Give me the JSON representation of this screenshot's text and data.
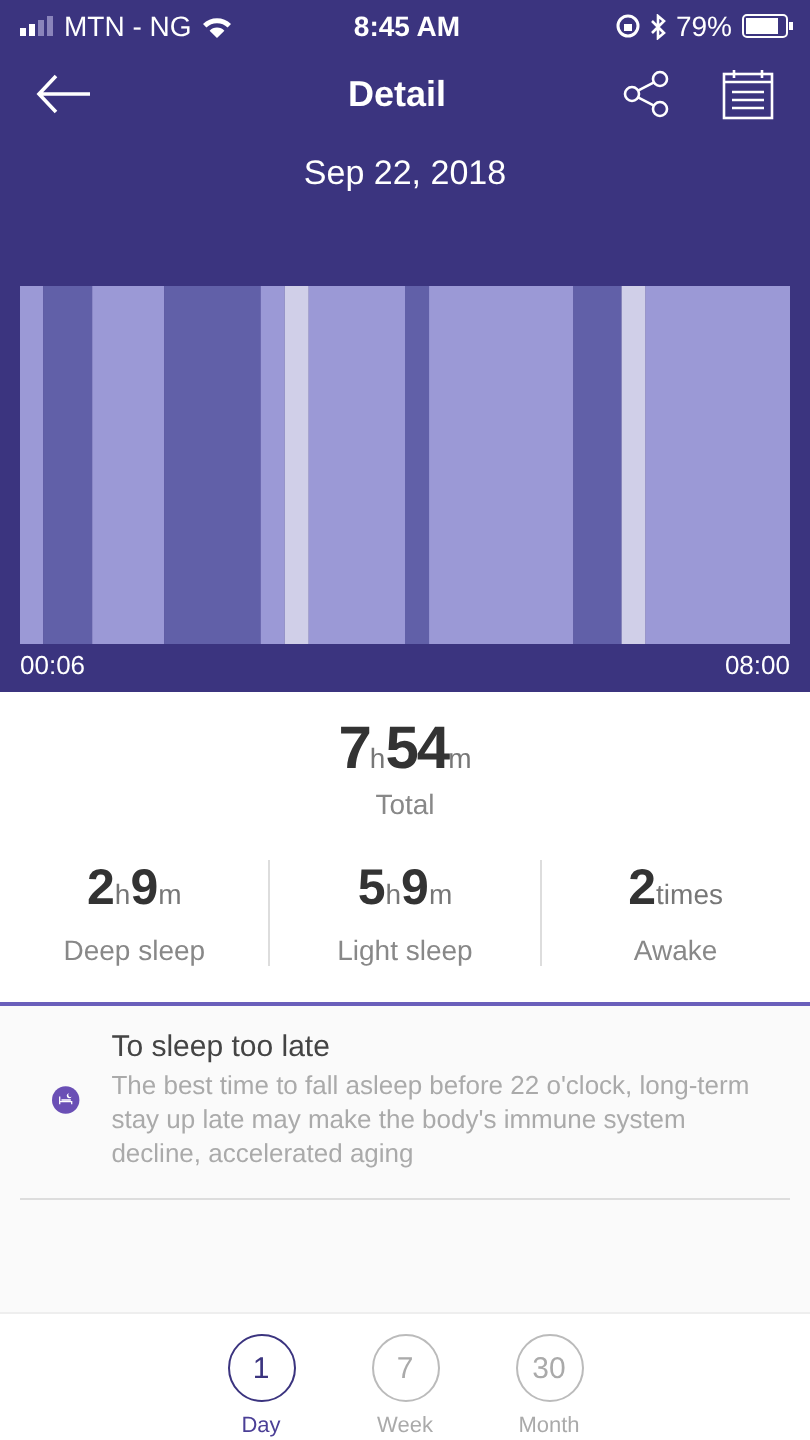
{
  "status_bar": {
    "carrier": "MTN - NG",
    "time": "8:45 AM",
    "battery": "79%"
  },
  "header": {
    "title": "Detail",
    "date": "Sep 22, 2018"
  },
  "sleep_chart": {
    "start": "00:06",
    "end": "08:00"
  },
  "total": {
    "hours": "7",
    "hours_unit": "h",
    "minutes": "54",
    "minutes_unit": "m",
    "label": "Total"
  },
  "stats": [
    {
      "parts": [
        {
          "value": "2",
          "unit": "h"
        },
        {
          "value": "9",
          "unit": "m"
        }
      ],
      "label": "Deep sleep"
    },
    {
      "parts": [
        {
          "value": "5",
          "unit": "h"
        },
        {
          "value": "9",
          "unit": "m"
        }
      ],
      "label": "Light sleep"
    },
    {
      "parts": [
        {
          "value": "2",
          "unit": "times"
        }
      ],
      "label": "Awake"
    }
  ],
  "tip": {
    "title": "To sleep too late",
    "text": "The best time to fall asleep before 22 o'clock, long-term stay up late may make the body's immune system decline, accelerated aging"
  },
  "tabs": [
    {
      "number": "1",
      "label": "Day",
      "selected": true
    },
    {
      "number": "7",
      "label": "Week",
      "selected": false
    },
    {
      "number": "30",
      "label": "Month",
      "selected": false
    }
  ]
}
